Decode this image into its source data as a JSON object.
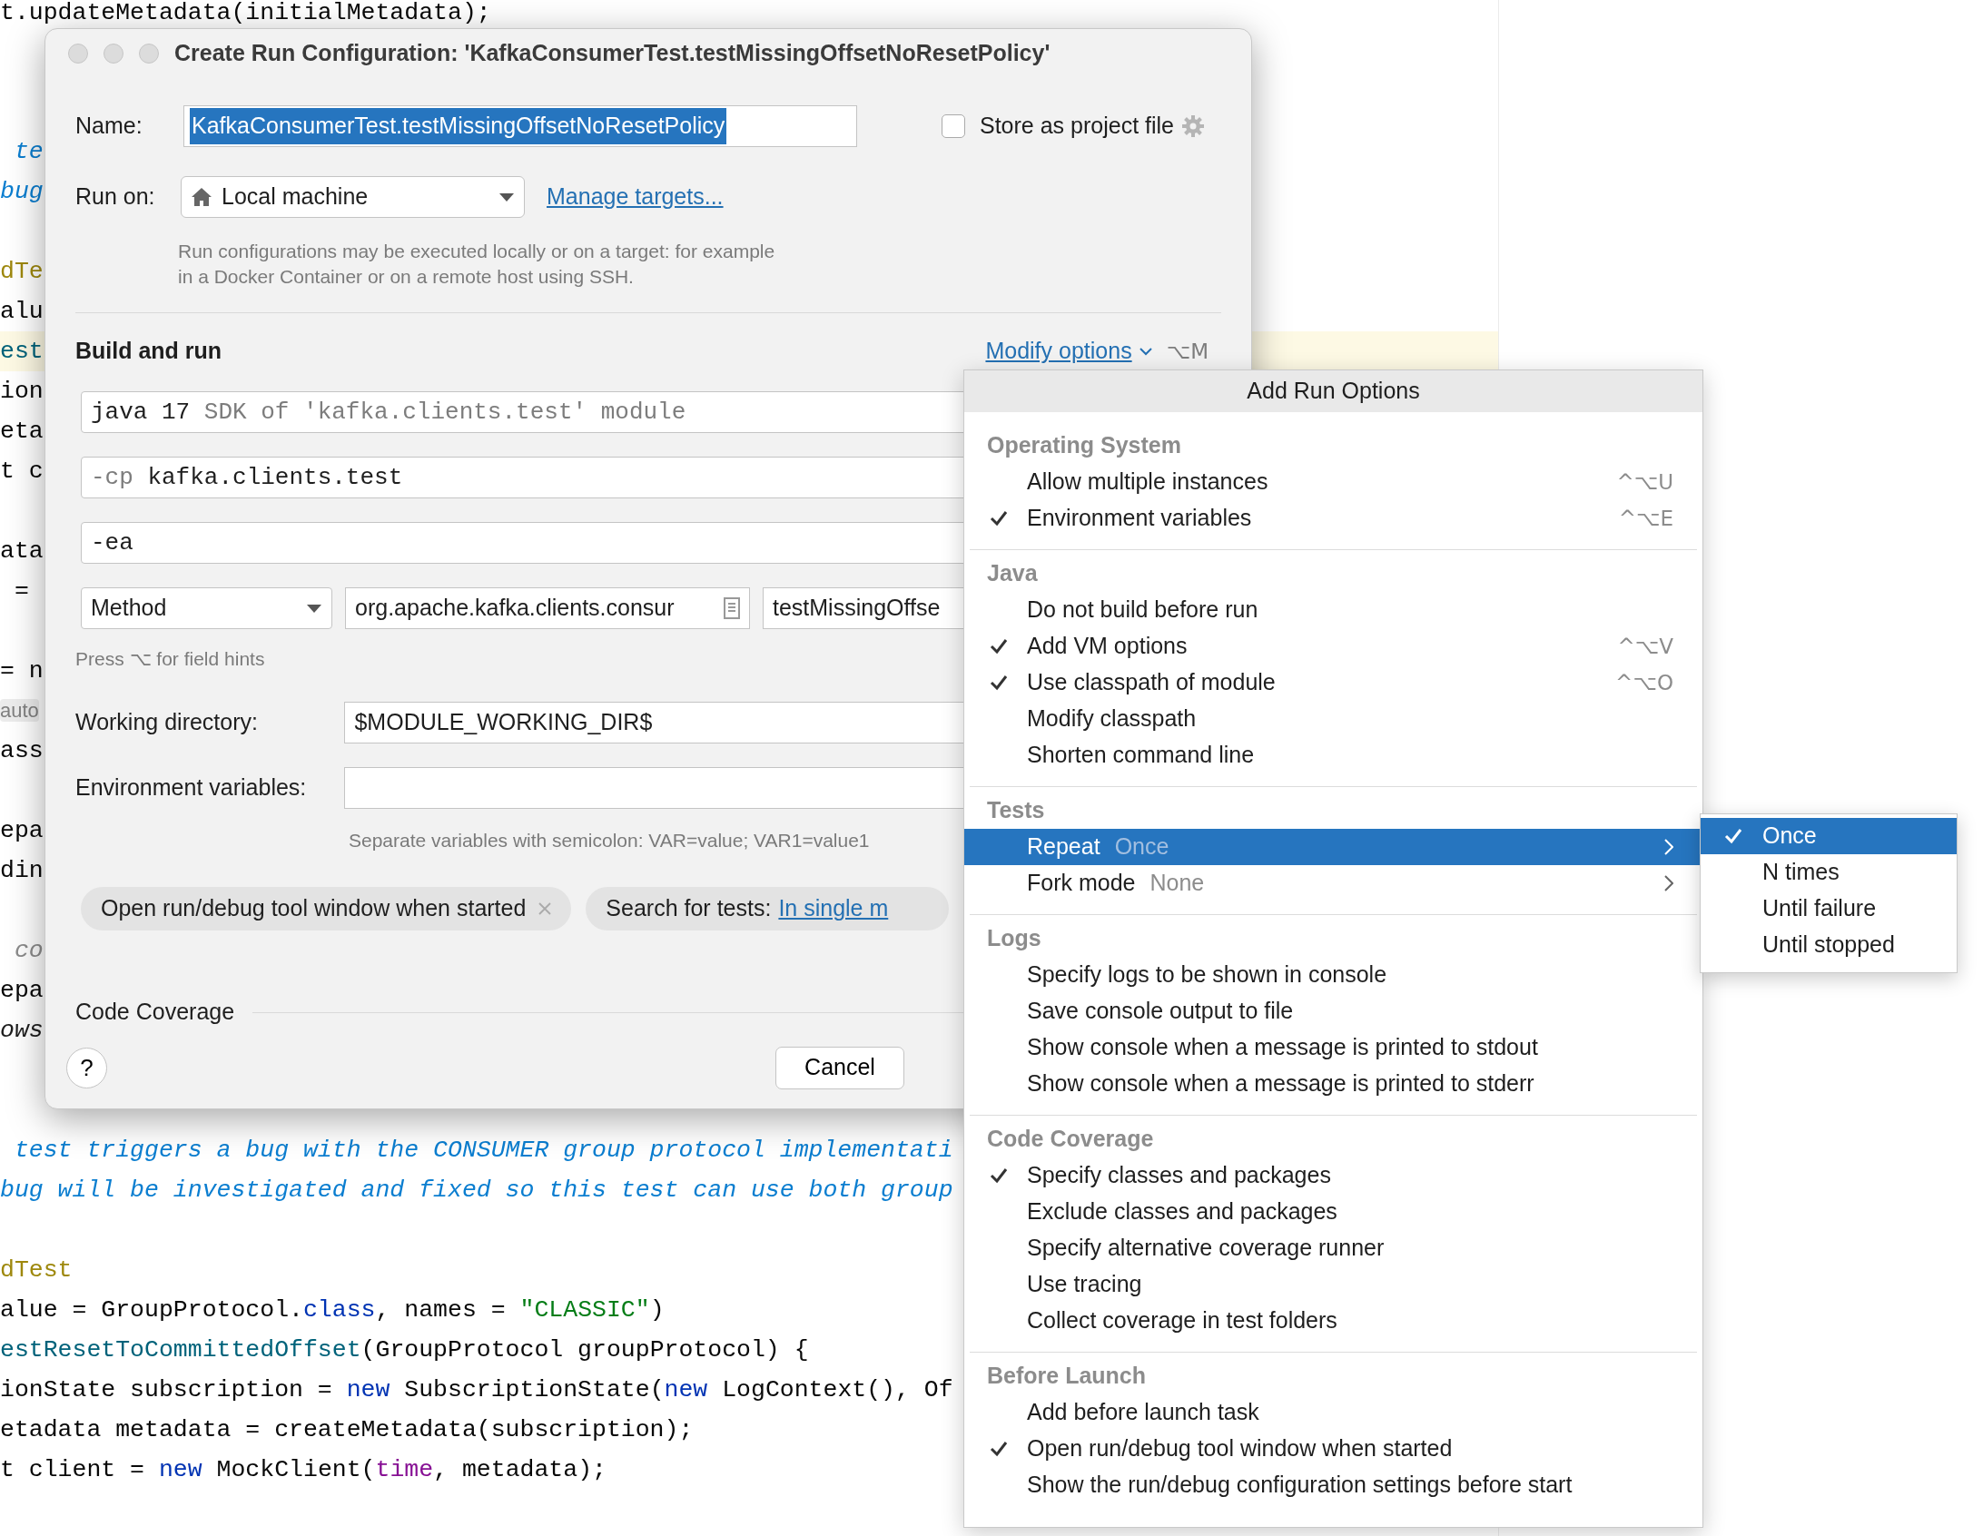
{
  "editor": {
    "top_line": {
      "segments": [
        {
          "text": "t.updateMetadata(initialMetadata);",
          "kind": "plain"
        }
      ]
    },
    "lines": [
      {
        "gap_before": false,
        "current": false,
        "segments": [
          {
            "text": " te",
            "kind": "comment"
          }
        ]
      },
      {
        "gap_before": false,
        "current": false,
        "segments": [
          {
            "text": "bug",
            "kind": "comment"
          }
        ]
      },
      {
        "gap_before": true,
        "current": false,
        "segments": [
          {
            "text": "dTe",
            "kind": "annotation"
          }
        ]
      },
      {
        "gap_before": false,
        "current": false,
        "segments": [
          {
            "text": "alu",
            "kind": "plain"
          }
        ]
      },
      {
        "gap_before": false,
        "current": true,
        "segments": [
          {
            "text": "est",
            "kind": "method"
          }
        ]
      },
      {
        "gap_before": false,
        "current": false,
        "segments": [
          {
            "text": "ion",
            "kind": "plain"
          }
        ]
      },
      {
        "gap_before": false,
        "current": false,
        "segments": [
          {
            "text": "eta",
            "kind": "plain"
          }
        ]
      },
      {
        "gap_before": false,
        "current": false,
        "segments": [
          {
            "text": "t c",
            "kind": "plain"
          }
        ]
      },
      {
        "gap_before": true,
        "current": false,
        "segments": [
          {
            "text": "ata",
            "kind": "plain"
          }
        ]
      },
      {
        "gap_before": false,
        "current": false,
        "segments": [
          {
            "text": " =",
            "kind": "plain"
          }
        ]
      },
      {
        "gap_before": true,
        "current": false,
        "segments": [
          {
            "text": "= n",
            "kind": "plain"
          }
        ]
      },
      {
        "gap_before": false,
        "current": false,
        "segments": [
          {
            "text": "auto",
            "kind": "hint"
          }
        ]
      },
      {
        "gap_before": false,
        "current": false,
        "segments": [
          {
            "text": "ass",
            "kind": "plain"
          }
        ]
      },
      {
        "gap_before": true,
        "current": false,
        "segments": [
          {
            "text": "epa",
            "kind": "plain"
          }
        ]
      },
      {
        "gap_before": false,
        "current": false,
        "segments": [
          {
            "text": "din",
            "kind": "plain"
          }
        ]
      },
      {
        "gap_before": true,
        "current": false,
        "segments": [
          {
            "text": " co",
            "kind": "muted"
          }
        ]
      },
      {
        "gap_before": false,
        "current": false,
        "segments": [
          {
            "text": "epa",
            "kind": "plain"
          }
        ]
      },
      {
        "gap_before": false,
        "current": false,
        "segments": [
          {
            "text": "ows",
            "kind": "italic"
          }
        ]
      }
    ],
    "lower_lines": [
      {
        "gap_before": false,
        "current": false,
        "segments": [
          {
            "text": " test triggers a bug with the CONSUMER group protocol implementati",
            "kind": "comment"
          }
        ]
      },
      {
        "gap_before": false,
        "current": false,
        "segments": [
          {
            "text": "bug will be investigated and fixed so this test can use both group",
            "kind": "comment"
          }
        ]
      },
      {
        "gap_before": true,
        "current": false,
        "segments": [
          {
            "text": "dTest",
            "kind": "annotation"
          }
        ]
      },
      {
        "gap_before": false,
        "current": false,
        "segments": [
          {
            "text": "alue = GroupProtocol.",
            "kind": "plain"
          },
          {
            "text": "class",
            "kind": "keyword"
          },
          {
            "text": ", names = ",
            "kind": "plain"
          },
          {
            "text": "\"CLASSIC\"",
            "kind": "string"
          },
          {
            "text": ")",
            "kind": "plain"
          }
        ]
      },
      {
        "gap_before": false,
        "current": false,
        "segments": [
          {
            "text": "estResetToCommittedOffset",
            "kind": "method"
          },
          {
            "text": "(GroupProtocol groupProtocol) {",
            "kind": "plain"
          }
        ]
      },
      {
        "gap_before": false,
        "current": false,
        "segments": [
          {
            "text": "ionState subscription = ",
            "kind": "plain"
          },
          {
            "text": "new",
            "kind": "keyword"
          },
          {
            "text": " SubscriptionState(",
            "kind": "plain"
          },
          {
            "text": "new",
            "kind": "keyword"
          },
          {
            "text": " LogContext(), Of",
            "kind": "plain"
          }
        ]
      },
      {
        "gap_before": false,
        "current": false,
        "segments": [
          {
            "text": "etadata metadata = createMetadata(subscription);",
            "kind": "plain"
          }
        ]
      },
      {
        "gap_before": false,
        "current": false,
        "segments": [
          {
            "text": "t client = ",
            "kind": "plain"
          },
          {
            "text": "new",
            "kind": "keyword"
          },
          {
            "text": " MockClient(",
            "kind": "plain"
          },
          {
            "text": "time",
            "kind": "field"
          },
          {
            "text": ", metadata);",
            "kind": "plain"
          }
        ]
      }
    ]
  },
  "dialog": {
    "title": "Create Run Configuration: 'KafkaConsumerTest.testMissingOffsetNoResetPolicy'",
    "name_label": "Name:",
    "name_value": "KafkaConsumerTest.testMissingOffsetNoResetPolicy",
    "name_text_selected": true,
    "store_checkbox": {
      "label": "Store as project file",
      "checked": false
    },
    "run_on_label": "Run on:",
    "run_on_value": "Local machine",
    "manage_link": "Manage targets...",
    "run_on_help": "Run configurations may be executed locally or on a target: for example in a Docker Container or on a remote host using SSH.",
    "section_title": "Build and run",
    "modify_options": "Modify options",
    "modify_shortcut": "⌥M",
    "command_fields": [
      {
        "segments": [
          {
            "text": "java 17",
            "kind": "value"
          },
          {
            "text": " SDK of 'kafka.clients.test' module",
            "kind": "dim"
          }
        ]
      },
      {
        "segments": [
          {
            "text": "-cp",
            "kind": "dim"
          },
          {
            "text": " kafka.clients.test",
            "kind": "value"
          }
        ]
      },
      {
        "segments": [
          {
            "text": "-ea",
            "kind": "value"
          }
        ]
      }
    ],
    "test_kind": "Method",
    "class_value": "org.apache.kafka.clients.consur",
    "method_value": "testMissingOffse",
    "field_hint": "Press ⌥ for field hints",
    "working_dir_label": "Working directory:",
    "working_dir_value": "$MODULE_WORKING_DIR$",
    "env_label": "Environment variables:",
    "env_help": "Separate variables with semicolon: VAR=value; VAR1=value1",
    "chips": [
      {
        "kind": "removable",
        "label": "Open run/debug tool window when started"
      },
      {
        "kind": "choice",
        "label": "Search for tests:",
        "value": "In single m"
      }
    ],
    "coverage_title": "Code Coverage",
    "help_label": "?",
    "cancel_label": "Cancel"
  },
  "menu": {
    "title": "Add Run Options",
    "sections": [
      {
        "title": "Operating System",
        "items": [
          {
            "label": "Allow multiple instances",
            "checked": false,
            "selected": false,
            "has_submenu": false,
            "shortcut": "^⌥U"
          },
          {
            "label": "Environment variables",
            "checked": true,
            "selected": false,
            "has_submenu": false,
            "shortcut": "^⌥E"
          }
        ]
      },
      {
        "title": "Java",
        "items": [
          {
            "label": "Do not build before run",
            "checked": false,
            "selected": false,
            "has_submenu": false
          },
          {
            "label": "Add VM options",
            "checked": true,
            "selected": false,
            "has_submenu": false,
            "shortcut": "^⌥V"
          },
          {
            "label": "Use classpath of module",
            "checked": true,
            "selected": false,
            "has_submenu": false,
            "shortcut": "^⌥O"
          },
          {
            "label": "Modify classpath",
            "checked": false,
            "selected": false,
            "has_submenu": false
          },
          {
            "label": "Shorten command line",
            "checked": false,
            "selected": false,
            "has_submenu": false
          }
        ]
      },
      {
        "title": "Tests",
        "items": [
          {
            "label": "Repeat",
            "hint": "Once",
            "checked": false,
            "selected": true,
            "has_submenu": true
          },
          {
            "label": "Fork mode",
            "hint": "None",
            "checked": false,
            "selected": false,
            "has_submenu": true
          }
        ]
      },
      {
        "title": "Logs",
        "items": [
          {
            "label": "Specify logs to be shown in console",
            "checked": false,
            "selected": false,
            "has_submenu": false
          },
          {
            "label": "Save console output to file",
            "checked": false,
            "selected": false,
            "has_submenu": false
          },
          {
            "label": "Show console when a message is printed to stdout",
            "checked": false,
            "selected": false,
            "has_submenu": false
          },
          {
            "label": "Show console when a message is printed to stderr",
            "checked": false,
            "selected": false,
            "has_submenu": false
          }
        ]
      },
      {
        "title": "Code Coverage",
        "items": [
          {
            "label": "Specify classes and packages",
            "checked": true,
            "selected": false,
            "has_submenu": false
          },
          {
            "label": "Exclude classes and packages",
            "checked": false,
            "selected": false,
            "has_submenu": false
          },
          {
            "label": "Specify alternative coverage runner",
            "checked": false,
            "selected": false,
            "has_submenu": false
          },
          {
            "label": "Use tracing",
            "checked": false,
            "selected": false,
            "has_submenu": false
          },
          {
            "label": "Collect coverage in test folders",
            "checked": false,
            "selected": false,
            "has_submenu": false
          }
        ]
      },
      {
        "title": "Before Launch",
        "items": [
          {
            "label": "Add before launch task",
            "checked": false,
            "selected": false,
            "has_submenu": false
          },
          {
            "label": "Open run/debug tool window when started",
            "checked": true,
            "selected": false,
            "has_submenu": false
          },
          {
            "label": "Show the run/debug configuration settings before start",
            "checked": false,
            "selected": false,
            "has_submenu": false
          }
        ]
      }
    ]
  },
  "submenu": {
    "items": [
      {
        "label": "Once",
        "checked": true,
        "selected": true
      },
      {
        "label": "N times",
        "checked": false,
        "selected": false
      },
      {
        "label": "Until failure",
        "checked": false,
        "selected": false
      },
      {
        "label": "Until stopped",
        "checked": false,
        "selected": false
      }
    ]
  }
}
